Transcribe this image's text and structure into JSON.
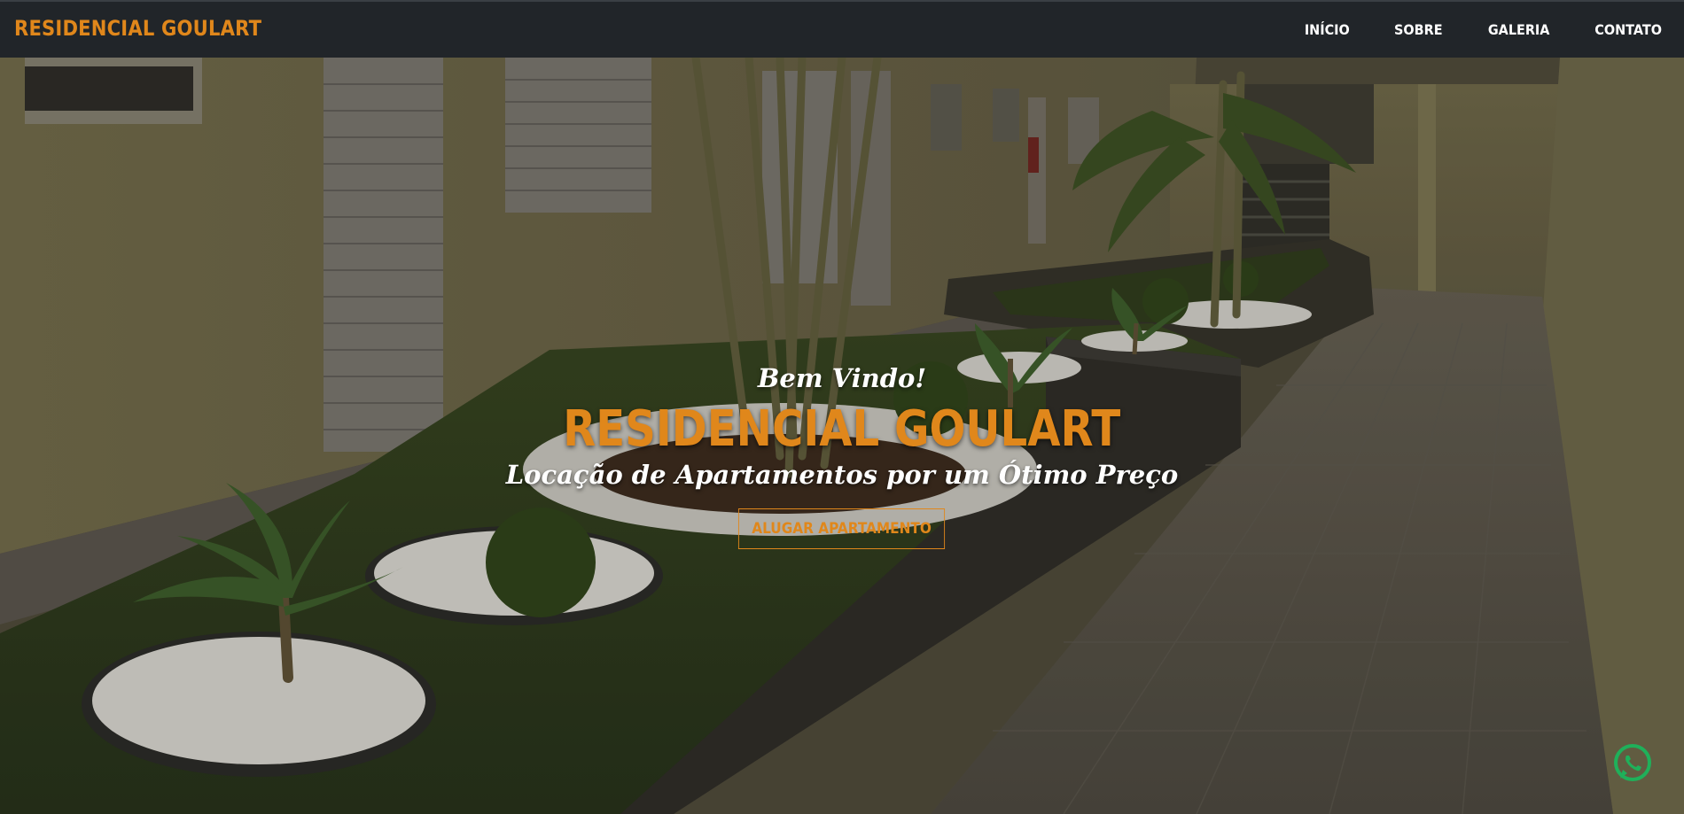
{
  "navbar": {
    "brand": "RESIDENCIAL GOULART",
    "links": [
      {
        "label": "INÍCIO"
      },
      {
        "label": "SOBRE"
      },
      {
        "label": "GALERIA"
      },
      {
        "label": "CONTATO"
      }
    ]
  },
  "hero": {
    "welcome": "Bem Vindo!",
    "title": "RESIDENCIAL GOULART",
    "subtitle": "Locação de Apartamentos por um Ótimo Preço",
    "cta_label": "ALUGAR APARTAMENTO",
    "background_image": "courtyard-photo"
  },
  "floating": {
    "whatsapp_icon": "whatsapp-icon"
  },
  "colors": {
    "accent": "#e0871b",
    "navbar_bg": "#212529",
    "text_light": "#ffffff"
  }
}
